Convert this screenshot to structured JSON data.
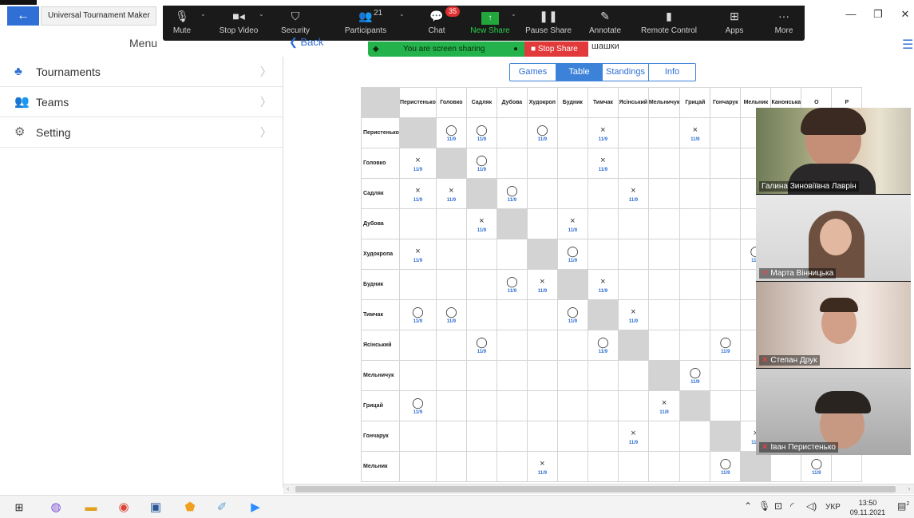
{
  "window": {
    "tab_title": "Universal Tournament Maker",
    "back_icon": "arrow-left-icon"
  },
  "zoom_toolbar": {
    "buttons": [
      {
        "label": "Mute",
        "icon": "mic-icon"
      },
      {
        "label": "Stop Video",
        "icon": "camera-icon"
      },
      {
        "label": "Security",
        "icon": "shield-icon"
      },
      {
        "label": "Participants",
        "icon": "people-icon",
        "count": "21"
      },
      {
        "label": "Chat",
        "icon": "chat-icon",
        "badge": "35"
      },
      {
        "label": "New Share",
        "icon": "share-icon"
      },
      {
        "label": "Pause Share",
        "icon": "pause-icon"
      },
      {
        "label": "Annotate",
        "icon": "pen-icon"
      },
      {
        "label": "Remote Control",
        "icon": "mouse-icon"
      },
      {
        "label": "Apps",
        "icon": "apps-icon"
      },
      {
        "label": "More",
        "icon": "more-icon"
      }
    ],
    "sharing_text": "You are screen sharing",
    "stop_share_label": "Stop Share",
    "under_text": "шашки",
    "share_color": "#23b24b",
    "stop_color": "#e23a3a"
  },
  "app": {
    "menu_title": "Menu",
    "back_label": "Back",
    "sidebar": [
      {
        "label": "Tournaments",
        "icon": "tournament-icon"
      },
      {
        "label": "Teams",
        "icon": "team-icon"
      },
      {
        "label": "Setting",
        "icon": "gear-icon"
      }
    ],
    "tabs": [
      {
        "label": "Games",
        "active": false
      },
      {
        "label": "Table",
        "active": true
      },
      {
        "label": "Standings",
        "active": false
      },
      {
        "label": "Info",
        "active": false
      }
    ]
  },
  "crosstable": {
    "columns": [
      "Перистенько",
      "Головко",
      "Садляк",
      "Дубова",
      "Худокроп",
      "Будник",
      "Тимчак",
      "Ясінський",
      "Мельничук",
      "Грицай",
      "Гончарук",
      "Мельник",
      "Канонська",
      "O",
      "P"
    ],
    "rows": [
      {
        "name": "Перистенько",
        "cells": {
          "1": "o",
          "2": "o",
          "4": "o",
          "6": "x",
          "9": "x"
        }
      },
      {
        "name": "Головко",
        "cells": {
          "0": "x",
          "2": "o",
          "6": "x"
        }
      },
      {
        "name": "Садляк",
        "cells": {
          "0": "x",
          "1": "x",
          "3": "o",
          "7": "x"
        }
      },
      {
        "name": "Дубова",
        "cells": {
          "2": "x",
          "5": "x"
        }
      },
      {
        "name": "Худокропа",
        "cells": {
          "0": "x",
          "5": "o",
          "11": "o"
        }
      },
      {
        "name": "Будник",
        "cells": {
          "3": "o",
          "4": "x",
          "6": "x"
        }
      },
      {
        "name": "Тимчак",
        "cells": {
          "0": "o",
          "1": "o",
          "5": "o",
          "7": "x"
        }
      },
      {
        "name": "Ясінський",
        "cells": {
          "2": "o",
          "6": "o",
          "10": "o"
        }
      },
      {
        "name": "Мельничук",
        "cells": {
          "9": "o"
        }
      },
      {
        "name": "Грицай",
        "cells": {
          "0": "o",
          "8": "x"
        }
      },
      {
        "name": "Гончарук",
        "cells": {
          "7": "x",
          "11": "x"
        }
      },
      {
        "name": "Мельник",
        "cells": {
          "4": "x",
          "10": "o",
          "13": "o"
        }
      }
    ],
    "date_label": "11/9",
    "symbols": {
      "o": "◯",
      "x": "×"
    }
  },
  "videos": [
    {
      "name": "Галина Зиновіївна Лаврін",
      "muted": false
    },
    {
      "name": "Марта Вінницька",
      "muted": true
    },
    {
      "name": "Степан Друк",
      "muted": true
    },
    {
      "name": "Іван Перистенько",
      "muted": true
    }
  ],
  "taskbar": {
    "language": "УКР",
    "time": "13:50",
    "date": "09.11.2021",
    "notif_count": "2"
  }
}
